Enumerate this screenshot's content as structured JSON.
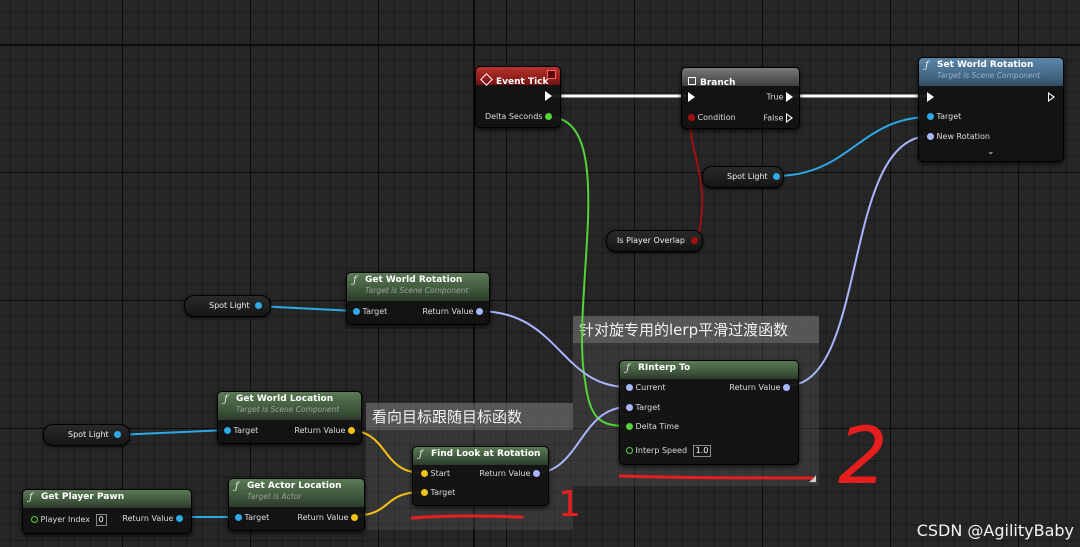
{
  "nodes": {
    "event_tick": {
      "title": "Event Tick",
      "delta": "Delta Seconds"
    },
    "branch": {
      "title": "Branch",
      "condition": "Condition",
      "true_label": "True",
      "false_label": "False"
    },
    "set_world_rotation": {
      "title": "Set World Rotation",
      "subtitle": "Target is Scene Component",
      "target": "Target",
      "new_rotation": "New Rotation"
    },
    "get_world_rotation": {
      "title": "Get World Rotation",
      "subtitle": "Target is Scene Component",
      "target": "Target",
      "ret": "Return Value"
    },
    "get_world_location": {
      "title": "Get World Location",
      "subtitle": "Target is Scene Component",
      "target": "Target",
      "ret": "Return Value"
    },
    "get_actor_location": {
      "title": "Get Actor Location",
      "subtitle": "Target is Actor",
      "target": "Target",
      "ret": "Return Value"
    },
    "get_player_pawn": {
      "title": "Get Player Pawn",
      "player_index": "Player Index",
      "player_index_value": "0",
      "ret": "Return Value"
    },
    "find_look_at": {
      "title": "Find Look at Rotation",
      "start": "Start",
      "target": "Target",
      "ret": "Return Value"
    },
    "rinterp": {
      "title": "RInterp To",
      "current": "Current",
      "target": "Target",
      "delta": "Delta Time",
      "speed": "Interp Speed",
      "speed_value": "1.0",
      "ret": "Return Value"
    }
  },
  "variables": {
    "spot_light_a": "Spot Light",
    "spot_light_b": "Spot Light",
    "spot_light_c": "Spot Light",
    "is_player_overlap": "Is Player Overlap"
  },
  "comments": {
    "rinterp_comment": "针对旋专用的lerp平滑过渡函数",
    "lookat_comment": "看向目标跟随目标函数"
  },
  "annotations": {
    "handwritten_one": "1",
    "handwritten_two": "2"
  },
  "watermark": "CSDN @AgilityBaby",
  "colors": {
    "exec_wire": "#ffffff",
    "object_wire": "#2ea8e6",
    "rotator_wire": "#a9b6ff",
    "vector_wire": "#f4c214",
    "float_wire": "#52d43a",
    "bool_wire": "#a01010",
    "ink": "#e81e1e"
  }
}
